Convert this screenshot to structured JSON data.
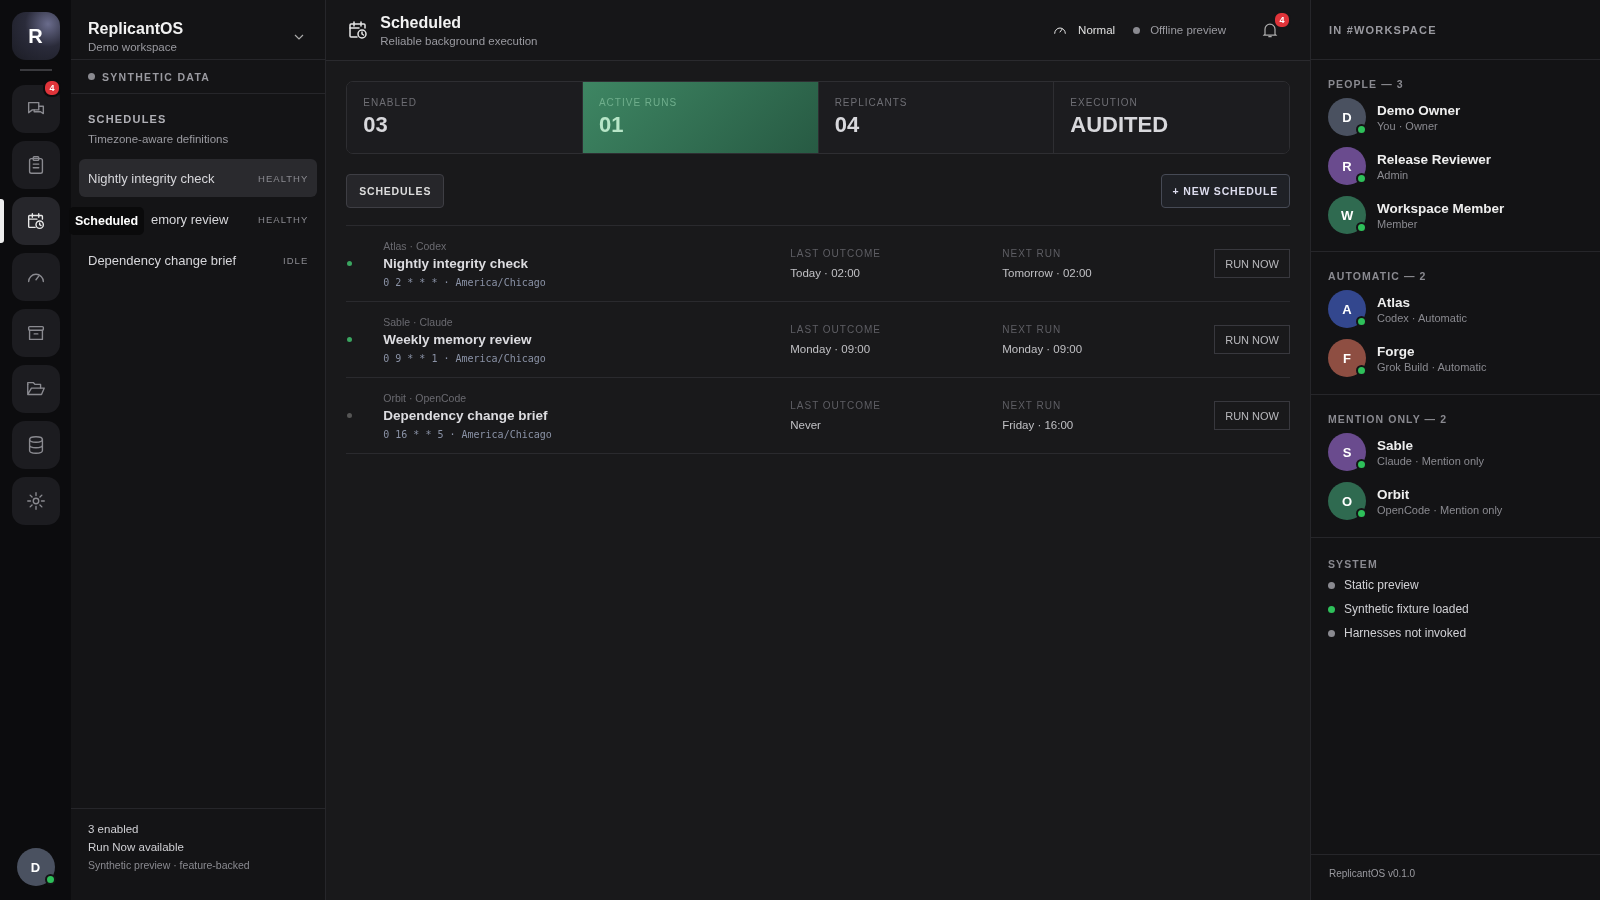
{
  "rail": {
    "logo": "R",
    "items": [
      {
        "selected": false,
        "badge": "4"
      },
      {
        "selected": false
      },
      {
        "selected": true
      },
      {
        "selected": false
      },
      {
        "selected": false
      },
      {
        "selected": false
      },
      {
        "selected": false
      },
      {
        "selected": false
      }
    ],
    "tooltip": {
      "label": "Scheduled"
    },
    "user": {
      "initial": "D",
      "online": true
    }
  },
  "sidebar": {
    "workspace": "ReplicantOS",
    "subtitle": "Demo workspace",
    "data_badge": "SYNTHETIC DATA",
    "section": "SCHEDULES",
    "section_note": "Timezone-aware definitions",
    "items": [
      {
        "label": "Nightly integrity check",
        "status": "HEALTHY",
        "selected": true
      },
      {
        "label": "emory review",
        "status": "HEALTHY",
        "selected": false
      },
      {
        "label": "Dependency change brief",
        "status": "IDLE",
        "selected": false
      }
    ],
    "footer": [
      "3 enabled",
      "Run Now available"
    ],
    "footer_note": "Synthetic preview · feature-backed"
  },
  "header": {
    "title": "Scheduled",
    "subtitle": "Reliable background execution",
    "mode": "Normal",
    "connection": "Offline preview",
    "notifications": "4"
  },
  "stats": [
    {
      "label": "ENABLED",
      "value": "03",
      "selected": false
    },
    {
      "label": "ACTIVE RUNS",
      "value": "01",
      "selected": true
    },
    {
      "label": "REPLICANTS",
      "value": "04",
      "selected": false
    },
    {
      "label": "EXECUTION",
      "value": "AUDITED",
      "selected": false
    }
  ],
  "toolbar": {
    "tab": "SCHEDULES",
    "new_button": "+ NEW SCHEDULE"
  },
  "schedules": [
    {
      "owner": "Atlas · Codex",
      "name": "Nightly integrity check",
      "cron": "0 2 * * * · America/Chicago",
      "last_label": "LAST OUTCOME",
      "last": "Today · 02:00",
      "next_label": "NEXT RUN",
      "next": "Tomorrow · 02:00",
      "action": "RUN NOW",
      "active": true
    },
    {
      "owner": "Sable · Claude",
      "name": "Weekly memory review",
      "cron": "0 9 * * 1 · America/Chicago",
      "last_label": "LAST OUTCOME",
      "last": "Monday · 09:00",
      "next_label": "NEXT RUN",
      "next": "Monday · 09:00",
      "action": "RUN NOW",
      "active": true
    },
    {
      "owner": "Orbit · OpenCode",
      "name": "Dependency change brief",
      "cron": "0 16 * * 5 · America/Chicago",
      "last_label": "LAST OUTCOME",
      "last": "Never",
      "next_label": "NEXT RUN",
      "next": "Friday · 16:00",
      "action": "RUN NOW",
      "active": false
    }
  ],
  "panel": {
    "title": "IN #WORKSPACE",
    "groups": [
      {
        "title": "PEOPLE — 3",
        "members": [
          {
            "initial": "D",
            "name": "Demo Owner",
            "role": "You · Owner",
            "color": "#4a5160"
          },
          {
            "initial": "R",
            "name": "Release Reviewer",
            "role": "Admin",
            "color": "#6a4b8e"
          },
          {
            "initial": "W",
            "name": "Workspace Member",
            "role": "Member",
            "color": "#2f6a50"
          }
        ]
      },
      {
        "title": "AUTOMATIC — 2",
        "members": [
          {
            "initial": "A",
            "name": "Atlas",
            "role": "Codex · Automatic",
            "color": "#33478e"
          },
          {
            "initial": "F",
            "name": "Forge",
            "role": "Grok Build · Automatic",
            "color": "#8e4e42"
          }
        ]
      },
      {
        "title": "MENTION ONLY — 2",
        "members": [
          {
            "initial": "S",
            "name": "Sable",
            "role": "Claude · Mention only",
            "color": "#6a4b8e"
          },
          {
            "initial": "O",
            "name": "Orbit",
            "role": "OpenCode · Mention only",
            "color": "#2f6a50"
          }
        ]
      }
    ],
    "system_title": "SYSTEM",
    "system": [
      {
        "label": "Static preview",
        "ok": false
      },
      {
        "label": "Synthetic fixture loaded",
        "ok": true
      },
      {
        "label": "Harnesses not invoked",
        "ok": false
      }
    ],
    "version": "ReplicantOS v0.1.0"
  }
}
